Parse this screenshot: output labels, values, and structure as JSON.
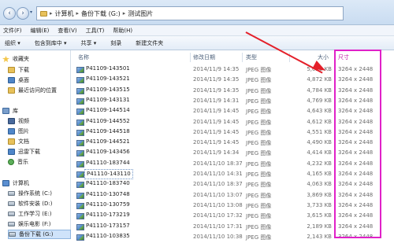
{
  "address": {
    "segments": [
      "计算机",
      "备份下载 (G:)",
      "测试图片"
    ]
  },
  "menu": [
    "文件(F)",
    "编辑(E)",
    "查看(V)",
    "工具(T)",
    "帮助(H)"
  ],
  "toolbar": [
    "组织 ▾",
    "包含到库中 ▾",
    "共享 ▾",
    "刻录",
    "新建文件夹"
  ],
  "sidebar": {
    "favorites": "收藏夹",
    "fav_items": [
      "下载",
      "桌面",
      "最近访问的位置"
    ],
    "libraries": "库",
    "lib_items": [
      "视频",
      "图片",
      "文档",
      "迅雷下载",
      "音乐"
    ],
    "computer": "计算机",
    "drives": [
      "操作系统 (C:)",
      "软件安装 (D:)",
      "工作学习 (E:)",
      "娱乐电影 (F:)",
      "备份下载 (G:)"
    ]
  },
  "columns": {
    "name": "名称",
    "date": "修改日期",
    "type": "类型",
    "size": "大小",
    "dimensions": "尺寸"
  },
  "files": [
    {
      "name": "P41109-143501",
      "date": "2014/11/9 14:35",
      "type": "JPEG 图像",
      "size": "5,020 KB",
      "dim": "3264 x 2448"
    },
    {
      "name": "P41109-143521",
      "date": "2014/11/9 14:35",
      "type": "JPEG 图像",
      "size": "4,872 KB",
      "dim": "3264 x 2448"
    },
    {
      "name": "P41109-143515",
      "date": "2014/11/9 14:35",
      "type": "JPEG 图像",
      "size": "4,784 KB",
      "dim": "3264 x 2448"
    },
    {
      "name": "P41109-143131",
      "date": "2014/11/9 14:31",
      "type": "JPEG 图像",
      "size": "4,769 KB",
      "dim": "3264 x 2448"
    },
    {
      "name": "P41109-144514",
      "date": "2014/11/9 14:45",
      "type": "JPEG 图像",
      "size": "4,643 KB",
      "dim": "3264 x 2448"
    },
    {
      "name": "P41109-144552",
      "date": "2014/11/9 14:45",
      "type": "JPEG 图像",
      "size": "4,612 KB",
      "dim": "3264 x 2448"
    },
    {
      "name": "P41109-144518",
      "date": "2014/11/9 14:45",
      "type": "JPEG 图像",
      "size": "4,551 KB",
      "dim": "3264 x 2448"
    },
    {
      "name": "P41109-144521",
      "date": "2014/11/9 14:45",
      "type": "JPEG 图像",
      "size": "4,490 KB",
      "dim": "3264 x 2448"
    },
    {
      "name": "P41109-143456",
      "date": "2014/11/9 14:34",
      "type": "JPEG 图像",
      "size": "4,414 KB",
      "dim": "3264 x 2448"
    },
    {
      "name": "P41110-183744",
      "date": "2014/11/10 18:37",
      "type": "JPEG 图像",
      "size": "4,232 KB",
      "dim": "3264 x 2448"
    },
    {
      "name": "P41110-143110",
      "date": "2014/11/10 14:31",
      "type": "JPEG 图像",
      "size": "4,165 KB",
      "dim": "3264 x 2448"
    },
    {
      "name": "P41110-183740",
      "date": "2014/11/10 18:37",
      "type": "JPEG 图像",
      "size": "4,063 KB",
      "dim": "3264 x 2448"
    },
    {
      "name": "P41110-130748",
      "date": "2014/11/10 13:07",
      "type": "JPEG 图像",
      "size": "3,869 KB",
      "dim": "3264 x 2448"
    },
    {
      "name": "P41110-130759",
      "date": "2014/11/10 13:08",
      "type": "JPEG 图像",
      "size": "3,733 KB",
      "dim": "3264 x 2448"
    },
    {
      "name": "P41110-173219",
      "date": "2014/11/10 17:32",
      "type": "JPEG 图像",
      "size": "3,615 KB",
      "dim": "3264 x 2448"
    },
    {
      "name": "P41110-173157",
      "date": "2014/11/10 17:31",
      "type": "JPEG 图像",
      "size": "2,189 KB",
      "dim": "3264 x 2448"
    },
    {
      "name": "P41110-103835",
      "date": "2014/11/10 10:38",
      "type": "JPEG 图像",
      "size": "2,143 KB",
      "dim": "3264 x 2448"
    }
  ],
  "selected_row": 10,
  "annotation": {
    "box_color": "#e021c8",
    "arrow_color": "#e4202a"
  }
}
